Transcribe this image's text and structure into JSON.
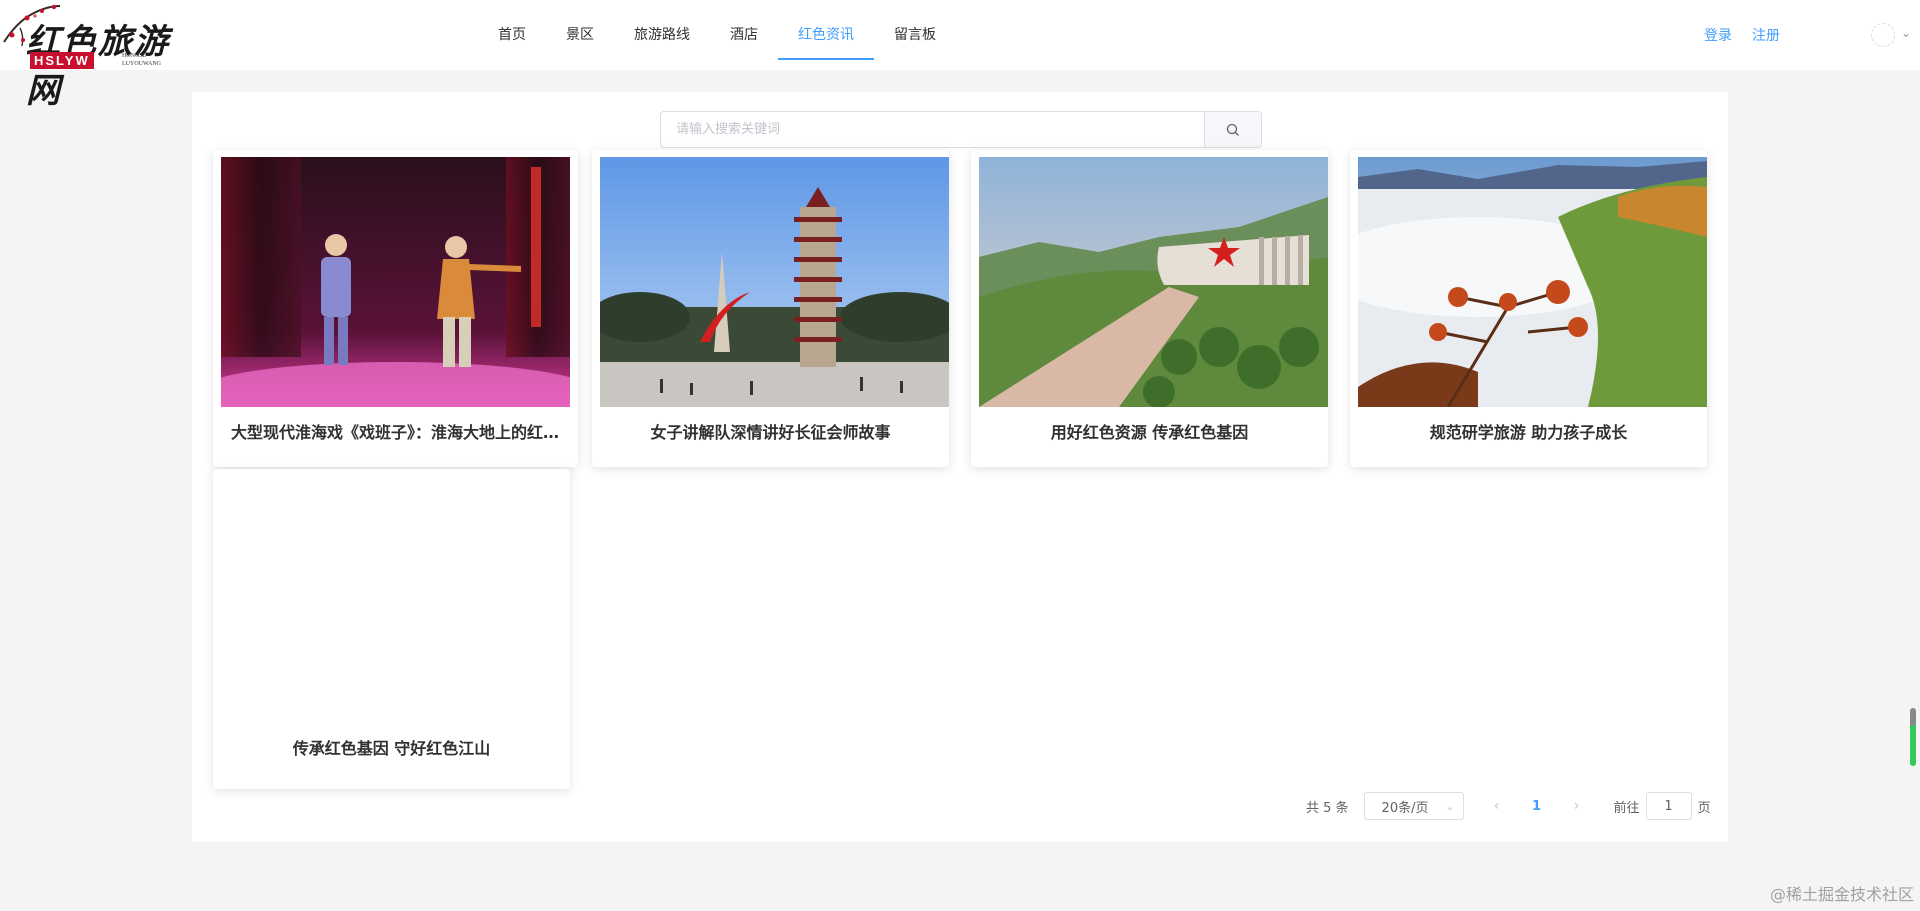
{
  "logo": {
    "cn": "红色旅游网",
    "en": "HSLYW",
    "sub1": "HONGSE",
    "sub2": "LUYOUWANG"
  },
  "nav": [
    {
      "label": "首页",
      "active": false
    },
    {
      "label": "景区",
      "active": false
    },
    {
      "label": "旅游路线",
      "active": false
    },
    {
      "label": "酒店",
      "active": false
    },
    {
      "label": "红色资讯",
      "active": true
    },
    {
      "label": "留言板",
      "active": false
    }
  ],
  "auth": {
    "login": "登录",
    "register": "注册"
  },
  "search": {
    "placeholder": "请输入搜索关键词",
    "value": ""
  },
  "cards": [
    {
      "title": "大型现代淮海戏《戏班子》：淮海大地上的红色传奇"
    },
    {
      "title": "女子讲解队深情讲好长征会师故事"
    },
    {
      "title": "用好红色资源 传承红色基因"
    },
    {
      "title": "规范研学旅游 助力孩子成长"
    },
    {
      "title": "传承红色基因 守好红色江山"
    }
  ],
  "pagination": {
    "total": "共 5 条",
    "page_size": "20条/页",
    "current_page": "1",
    "goto_prefix": "前往",
    "goto_value": "1",
    "goto_suffix": "页"
  },
  "watermark": "@稀土掘金技术社区",
  "colors": {
    "accent": "#409eff",
    "logo_red": "#c8102e"
  },
  "icons": {
    "search": "search-icon",
    "prev": "chevron-left-icon",
    "next": "chevron-right-icon",
    "dropdown": "chevron-down-icon"
  }
}
